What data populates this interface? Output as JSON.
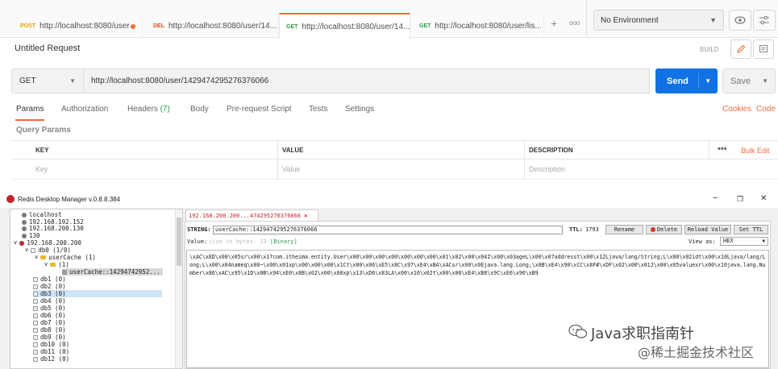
{
  "postman": {
    "tabs": [
      {
        "method": "POST",
        "url": "http://localhost:8080/user",
        "unsaved": true
      },
      {
        "method": "DEL",
        "url": "http://localhost:8080/user/14...",
        "unsaved": true
      },
      {
        "method": "GET",
        "url": "http://localhost:8080/user/14...",
        "unsaved": true,
        "active": true
      },
      {
        "method": "GET",
        "url": "http://localhost:8080/user/lis...",
        "unsaved": true
      }
    ],
    "add_tab_icon": "plus-icon",
    "more_tabs_label": "ooo",
    "environment": "No Environment",
    "request_title": "Untitled Request",
    "build_label": "BUILD",
    "request_method": "GET",
    "request_url": "http://localhost:8080/user/1429474295276376066",
    "send_label": "Send",
    "save_label": "Save",
    "subtabs": {
      "params": "Params",
      "authorization": "Authorization",
      "headers": "Headers",
      "headers_count": "(7)",
      "body": "Body",
      "prerequest": "Pre-request Script",
      "tests": "Tests",
      "settings": "Settings"
    },
    "cookies_label": "Cookies",
    "code_label": "Code",
    "query_params_title": "Query Params",
    "table": {
      "col_key": "KEY",
      "col_value": "VALUE",
      "col_description": "DESCRIPTION",
      "more": "•••",
      "bulk_edit": "Bulk Edit",
      "ph_key": "Key",
      "ph_value": "Value",
      "ph_description": "Description"
    },
    "accent_color": "#f26b3a",
    "send_color": "#1272e4"
  },
  "rdm": {
    "window_title": "Redis Desktop Manager v.0.8.8.384",
    "min_label": "−",
    "max_label": "❐",
    "close_label": "✕",
    "tree": [
      {
        "label": "localhost",
        "type": "server"
      },
      {
        "label": "192.168.192.152",
        "type": "server"
      },
      {
        "label": "192.168.200.130",
        "type": "server"
      },
      {
        "label": "130",
        "type": "server"
      },
      {
        "label": "192.168.200.200",
        "type": "server-open"
      },
      {
        "label": "db0  (1/0)",
        "type": "db-open"
      },
      {
        "label": "userCache (1)",
        "type": "folder"
      },
      {
        "label": "(1)",
        "type": "folder2"
      },
      {
        "label": "userCache::14294742952...",
        "type": "key"
      },
      {
        "label": "db1  (0)",
        "type": "db"
      },
      {
        "label": "db2  (0)",
        "type": "db"
      },
      {
        "label": "db3  (0)",
        "type": "db"
      },
      {
        "label": "db4  (0)",
        "type": "db"
      },
      {
        "label": "db5  (0)",
        "type": "db"
      },
      {
        "label": "db6  (0)",
        "type": "db"
      },
      {
        "label": "db7  (0)",
        "type": "db"
      },
      {
        "label": "db8  (0)",
        "type": "db"
      },
      {
        "label": "db9  (0)",
        "type": "db"
      },
      {
        "label": "db10  (0)",
        "type": "db"
      },
      {
        "label": "db11  (0)",
        "type": "db"
      },
      {
        "label": "db12  (0)",
        "type": "db"
      }
    ],
    "key_tab": "192.168.200.200...474295276376066",
    "type_label": "STRING:",
    "key_value": "userCache::1429474295276376066",
    "ttl_label": "TTL:",
    "ttl_value": "1793",
    "rename_label": "Rename",
    "delete_label": "Delete",
    "reload_label": "Reload Value",
    "setttl_label": "Set TTL",
    "value_label": "Value:",
    "value_hint": "size in bytes: 23",
    "value_binary": "[Binary]",
    "view_as_label": "View as:",
    "view_as_value": "HEX",
    "value_content": "\\xAC\\xED\\x00\\x05sr\\x00\\x17com.itheima.entity.User\\x00\\x00\\x00\\x00\\x00\\x00\\x00\\x01\\x02\\x00\\x04I\\x00\\x03ageL\\x00\\x07addresst\\x00\\x12Ljava/lang/String;L\\x00\\x02idt\\x00\\x10Ljava/lang/Long;L\\x00\\x04nameq\\x00~\\x00\\x01xp\\x00\\x00\\x00\\x1Ct\\x00\\x06\\xE5\\x8C\\x97\\xE4\\xBA\\xACsr\\x00\\x0Ejava.lang.Long;\\x8B\\xE4\\x90\\xCC\\x8F#\\xDF\\x02\\x00\\x01J\\x00\\x05valuexr\\x00\\x10java.lang.Number\\x86\\xAC\\x95\\x1D\\x0B\\x94\\xE0\\x8B\\x02\\x00\\x00xp\\x13\\xD6\\x83LA\\x00\\x10\\x02t\\x00\\x06\\xE4\\xB8\\x9C\\xE6\\x96\\xB9",
    "watermark_line1": "Java求职指南针",
    "watermark_line2": "@稀土掘金技术社区"
  }
}
